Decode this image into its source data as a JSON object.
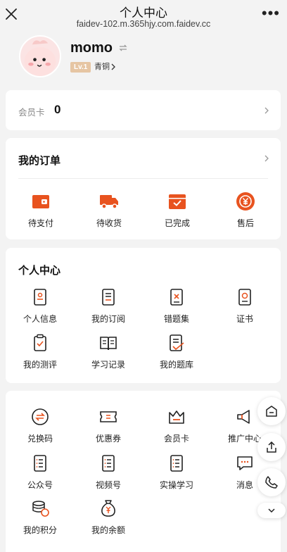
{
  "window": {
    "title": "个人中心",
    "url": "faidev-102.m.365hjy.com.faidev.cc"
  },
  "profile": {
    "username": "momo",
    "level_badge": "Lv.1",
    "level_name": "青铜"
  },
  "member_card": {
    "label": "会员卡",
    "value": "0"
  },
  "orders": {
    "title": "我的订单",
    "items": [
      {
        "label": "待支付",
        "icon": "wallet-icon"
      },
      {
        "label": "待收货",
        "icon": "truck-icon"
      },
      {
        "label": "已完成",
        "icon": "box-check-icon"
      },
      {
        "label": "售后",
        "icon": "yen-refresh-icon"
      }
    ]
  },
  "personal_center": {
    "title": "个人中心",
    "items": [
      {
        "label": "个人信息",
        "icon": "id-card-icon"
      },
      {
        "label": "我的订阅",
        "icon": "book-icon"
      },
      {
        "label": "错题集",
        "icon": "wrong-book-icon"
      },
      {
        "label": "证书",
        "icon": "certificate-icon"
      },
      {
        "label": "我的测评",
        "icon": "clipboard-check-icon"
      },
      {
        "label": "学习记录",
        "icon": "open-book-icon"
      },
      {
        "label": "我的题库",
        "icon": "question-bank-icon"
      }
    ]
  },
  "tools": {
    "items": [
      {
        "label": "兑换码",
        "icon": "exchange-icon"
      },
      {
        "label": "优惠券",
        "icon": "coupon-icon"
      },
      {
        "label": "会员卡",
        "icon": "crown-icon"
      },
      {
        "label": "推广中心",
        "icon": "megaphone-icon"
      },
      {
        "label": "公众号",
        "icon": "list-doc-icon"
      },
      {
        "label": "视频号",
        "icon": "list-doc-icon"
      },
      {
        "label": "实操学习",
        "icon": "list-doc-icon"
      },
      {
        "label": "消息",
        "icon": "chat-icon"
      },
      {
        "label": "我的积分",
        "icon": "coins-icon"
      },
      {
        "label": "我的余额",
        "icon": "money-bag-icon"
      }
    ]
  },
  "colors": {
    "accent": "#e8531f",
    "background": "#f3f3f3",
    "card": "#ffffff"
  }
}
